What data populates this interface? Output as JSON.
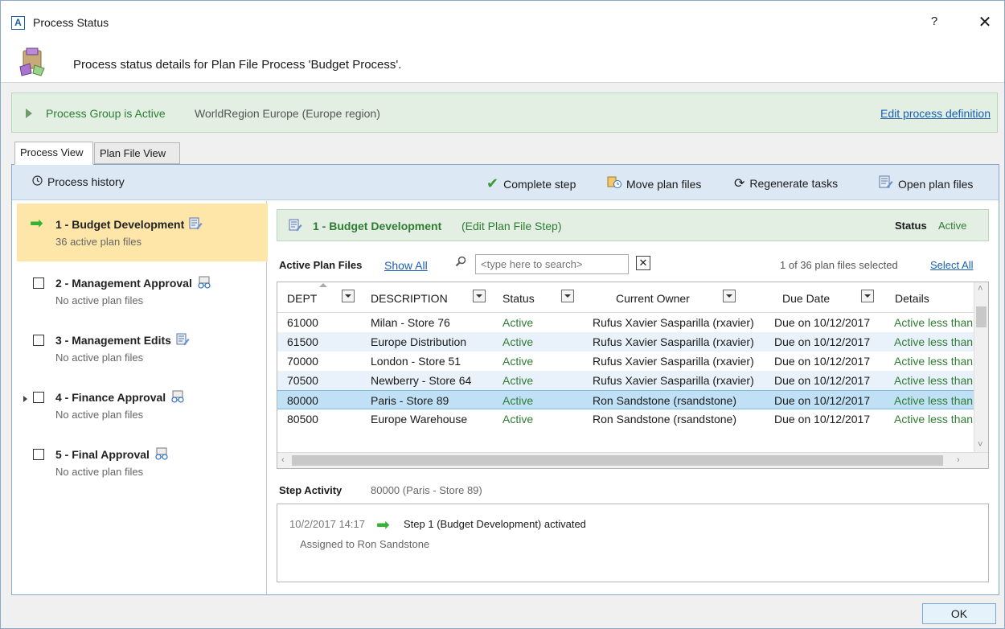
{
  "window": {
    "app_icon": "A",
    "title": "Process Status",
    "help_label": "?",
    "close_label": "✕",
    "header_text": "Process status details for Plan File Process 'Budget Process'."
  },
  "group": {
    "status": "Process Group is Active",
    "region": "WorldRegion Europe (Europe region)",
    "edit_link": "Edit process definition"
  },
  "tabs": [
    {
      "label": "Process View",
      "active": true
    },
    {
      "label": "Plan File View",
      "active": false
    }
  ],
  "toolbar": {
    "history": "Process history",
    "complete": "Complete step",
    "move": "Move plan files",
    "regenerate": "Regenerate tasks",
    "open": "Open plan files"
  },
  "steps": [
    {
      "label": "1 - Budget Development",
      "sub": "36 active plan files",
      "type": "edit-icon"
    },
    {
      "label": "2 - Management Approval",
      "sub": "No active plan files",
      "type": "approval-icon"
    },
    {
      "label": "3 - Management Edits",
      "sub": "No active plan files",
      "type": "edit-icon"
    },
    {
      "label": "4 - Finance Approval",
      "sub": "No active plan files",
      "type": "approval-icon"
    },
    {
      "label": "5 - Final Approval",
      "sub": "No active plan files",
      "type": "approval-icon"
    }
  ],
  "step_header": {
    "title": "1 - Budget Development",
    "type": "(Edit Plan File Step)",
    "status_label": "Status",
    "status_value": "Active"
  },
  "plan_files": {
    "label": "Active Plan Files",
    "show_all": "Show All",
    "search_placeholder": "<type here to search>",
    "clear_label": "✕",
    "selected_count": "1 of 36 plan files selected",
    "select_all": "Select All"
  },
  "grid": {
    "columns": [
      "DEPT",
      "DESCRIPTION",
      "Status",
      "Current Owner",
      "Due Date",
      "Details"
    ],
    "rows": [
      {
        "dept": "61000",
        "desc": "Milan - Store 76",
        "status": "Active",
        "owner": "Rufus Xavier Sasparilla (rxavier)",
        "due": "Due on 10/12/2017",
        "details": "Active less than"
      },
      {
        "dept": "61500",
        "desc": "Europe Distribution",
        "status": "Active",
        "owner": "Rufus Xavier Sasparilla (rxavier)",
        "due": "Due on 10/12/2017",
        "details": "Active less than"
      },
      {
        "dept": "70000",
        "desc": "London - Store 51",
        "status": "Active",
        "owner": "Rufus Xavier Sasparilla (rxavier)",
        "due": "Due on 10/12/2017",
        "details": "Active less than"
      },
      {
        "dept": "70500",
        "desc": "Newberry - Store 64",
        "status": "Active",
        "owner": "Rufus Xavier Sasparilla (rxavier)",
        "due": "Due on 10/12/2017",
        "details": "Active less than"
      },
      {
        "dept": "80000",
        "desc": "Paris - Store 89",
        "status": "Active",
        "owner": "Ron Sandstone (rsandstone)",
        "due": "Due on 10/12/2017",
        "details": "Active less than"
      },
      {
        "dept": "80500",
        "desc": "Europe Warehouse",
        "status": "Active",
        "owner": "Ron Sandstone (rsandstone)",
        "due": "Due on 10/12/2017",
        "details": "Active less than"
      }
    ]
  },
  "step_activity": {
    "label": "Step Activity",
    "item": "80000 (Paris - Store 89)",
    "time": "10/2/2017 14:17",
    "message": "Step 1 (Budget Development) activated",
    "assigned": "Assigned to Ron Sandstone"
  },
  "ok_label": "OK",
  "colors": {
    "accent_green": "#2e7d32",
    "link_blue": "#1a5fb4",
    "selected_step": "#fde6a8",
    "toolbar_bg": "#dde8f5"
  }
}
